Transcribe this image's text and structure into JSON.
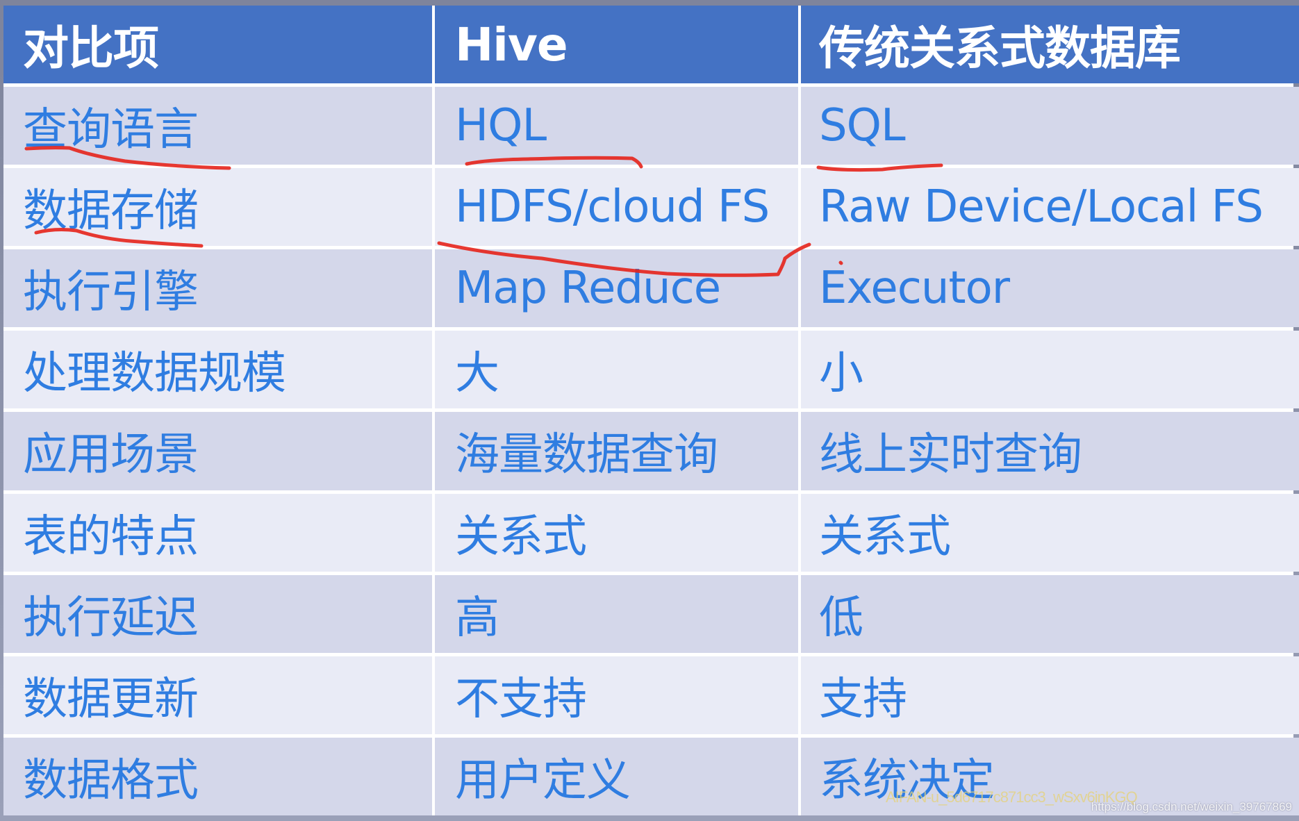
{
  "table": {
    "headers": [
      "对比项",
      "Hive",
      "传统关系式数据库"
    ],
    "rows": [
      [
        "查询语言",
        "HQL",
        "SQL"
      ],
      [
        "数据存储",
        "HDFS/cloud FS",
        "Raw Device/Local FS"
      ],
      [
        "执行引擎",
        "Map Reduce",
        "Executor"
      ],
      [
        "处理数据规模",
        "大",
        "小"
      ],
      [
        "应用场景",
        "海量数据查询",
        "线上实时查询"
      ],
      [
        "表的特点",
        "关系式",
        "关系式"
      ],
      [
        "执行延迟",
        "高",
        "低"
      ],
      [
        "数据更新",
        "不支持",
        "支持"
      ],
      [
        "数据格式",
        "用户定义",
        "系统决定"
      ]
    ]
  },
  "colors": {
    "header_bg": "#4472c4",
    "header_text": "#ffffff",
    "body_text": "#2f7de1",
    "row_odd": "#d4d7ea",
    "row_even": "#e9ebf6",
    "annotation_ink": "#e5231b"
  },
  "watermarks": {
    "overlay": "AIFAN-u_5d6717c871cc3_wSxv6inKGQ",
    "source": "https://blog.csdn.net/weixin_39767869"
  }
}
